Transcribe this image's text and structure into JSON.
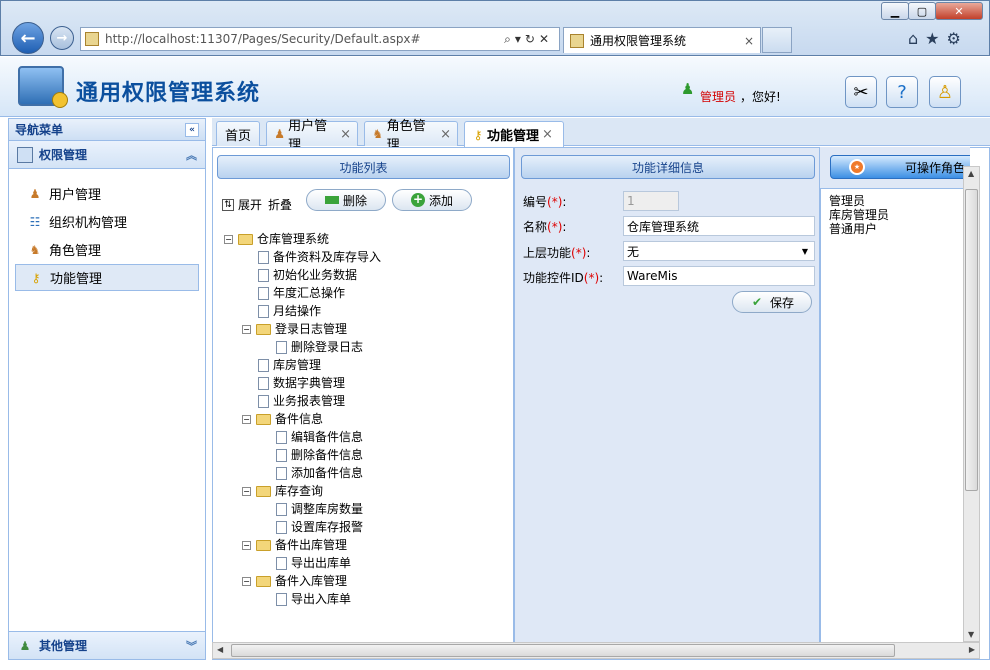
{
  "browser": {
    "url": "http://localhost:11307/Pages/Security/Default.aspx#",
    "tab_title": "通用权限管理系统",
    "tab_close": "×"
  },
  "app": {
    "title": "通用权限管理系统",
    "user": "管理员",
    "greeting": "，您好!"
  },
  "nav": {
    "header": "导航菜单",
    "section": "权限管理",
    "items": [
      {
        "label": "用户管理"
      },
      {
        "label": "组织机构管理"
      },
      {
        "label": "角色管理"
      },
      {
        "label": "功能管理"
      }
    ],
    "footer_section": "其他管理"
  },
  "tabs": [
    {
      "label": "首页"
    },
    {
      "label": "用户管理"
    },
    {
      "label": "角色管理"
    },
    {
      "label": "功能管理"
    }
  ],
  "function_list": {
    "header": "功能列表",
    "expand": "展开",
    "collapse": "折叠",
    "delete_btn": "删除",
    "add_btn": "添加",
    "tree": [
      {
        "label": "仓库管理系统",
        "level": 0,
        "type": "folder"
      },
      {
        "label": "备件资料及库存导入",
        "level": 1,
        "type": "file"
      },
      {
        "label": "初始化业务数据",
        "level": 1,
        "type": "file"
      },
      {
        "label": "年度汇总操作",
        "level": 1,
        "type": "file"
      },
      {
        "label": "月结操作",
        "level": 1,
        "type": "file"
      },
      {
        "label": "登录日志管理",
        "level": 1,
        "type": "folder"
      },
      {
        "label": "删除登录日志",
        "level": 2,
        "type": "file"
      },
      {
        "label": "库房管理",
        "level": 1,
        "type": "file"
      },
      {
        "label": "数据字典管理",
        "level": 1,
        "type": "file"
      },
      {
        "label": "业务报表管理",
        "level": 1,
        "type": "file"
      },
      {
        "label": "备件信息",
        "level": 1,
        "type": "folder"
      },
      {
        "label": "编辑备件信息",
        "level": 2,
        "type": "file"
      },
      {
        "label": "删除备件信息",
        "level": 2,
        "type": "file"
      },
      {
        "label": "添加备件信息",
        "level": 2,
        "type": "file"
      },
      {
        "label": "库存查询",
        "level": 1,
        "type": "folder"
      },
      {
        "label": "调整库房数量",
        "level": 2,
        "type": "file"
      },
      {
        "label": "设置库存报警",
        "level": 2,
        "type": "file"
      },
      {
        "label": "备件出库管理",
        "level": 1,
        "type": "folder"
      },
      {
        "label": "导出出库单",
        "level": 2,
        "type": "file"
      },
      {
        "label": "备件入库管理",
        "level": 1,
        "type": "folder"
      },
      {
        "label": "导出入库单",
        "level": 2,
        "type": "file"
      }
    ]
  },
  "detail": {
    "header": "功能详细信息",
    "fields": [
      {
        "label": "编号",
        "value": "1"
      },
      {
        "label": "名称",
        "value": "仓库管理系统"
      },
      {
        "label": "上层功能",
        "value": "无"
      },
      {
        "label": "功能控件ID",
        "value": "WareMis"
      }
    ],
    "required_mark": "(*)",
    "colon": ":",
    "save_btn": "保存"
  },
  "roles": {
    "header": "可操作角色",
    "items": [
      "管理员",
      "库房管理员",
      "普通用户"
    ]
  }
}
